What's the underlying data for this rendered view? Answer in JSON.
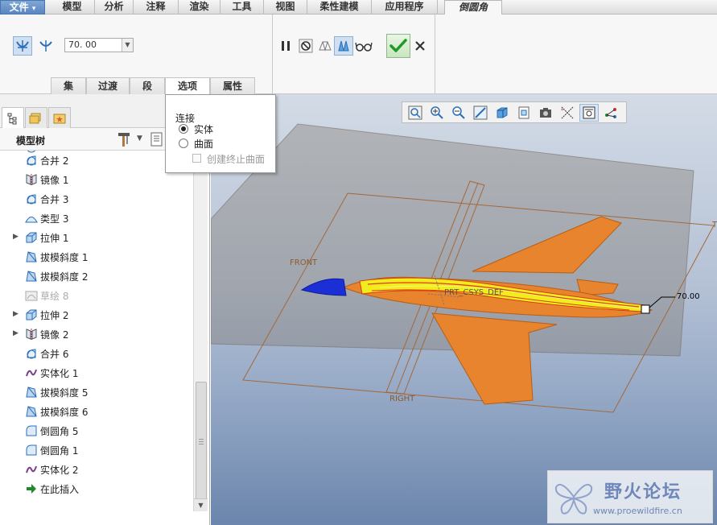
{
  "menu": {
    "tabs": [
      "文件",
      "模型",
      "分析",
      "注释",
      "渲染",
      "工具",
      "视图",
      "柔性建模",
      "应用程序",
      "倒圆角"
    ],
    "file_arrow": "▾"
  },
  "ribbon": {
    "radius_value": "70. 00",
    "slide_tabs": [
      "集",
      "过渡",
      "段",
      "选项",
      "属性"
    ]
  },
  "options_popup": {
    "title": "连接",
    "options": [
      "实体",
      "曲面"
    ],
    "selected": "实体",
    "checkbox_label": "创建终止曲面",
    "checkbox_checked": false
  },
  "model_tree": {
    "title": "模型树",
    "items": [
      {
        "label": "合并 2",
        "icon": "merge-icon",
        "expandable": false,
        "dim": false
      },
      {
        "label": "镜像 1",
        "icon": "mirror-icon",
        "expandable": false,
        "dim": false
      },
      {
        "label": "合并 3",
        "icon": "merge-icon",
        "expandable": false,
        "dim": false
      },
      {
        "label": "类型 3",
        "icon": "style-icon",
        "expandable": false,
        "dim": false
      },
      {
        "label": "拉伸 1",
        "icon": "extrude-icon",
        "expandable": true,
        "dim": false
      },
      {
        "label": "拔模斜度 1",
        "icon": "draft-icon",
        "expandable": false,
        "dim": false
      },
      {
        "label": "拔模斜度 2",
        "icon": "draft-icon",
        "expandable": false,
        "dim": false
      },
      {
        "label": "草绘 8",
        "icon": "sketch-icon",
        "expandable": false,
        "dim": true
      },
      {
        "label": "拉伸 2",
        "icon": "extrude-icon",
        "expandable": true,
        "dim": false
      },
      {
        "label": "镜像 2",
        "icon": "mirror-icon",
        "expandable": true,
        "dim": false
      },
      {
        "label": "合并 6",
        "icon": "merge-icon",
        "expandable": false,
        "dim": false
      },
      {
        "label": "实体化 1",
        "icon": "solidify-icon",
        "expandable": false,
        "dim": false
      },
      {
        "label": "拔模斜度 5",
        "icon": "draft-icon",
        "expandable": false,
        "dim": false
      },
      {
        "label": "拔模斜度 6",
        "icon": "draft-icon",
        "expandable": false,
        "dim": false
      },
      {
        "label": "倒圆角 5",
        "icon": "round-icon",
        "expandable": false,
        "dim": false
      },
      {
        "label": "倒圆角 1",
        "icon": "round-icon",
        "expandable": false,
        "dim": false
      },
      {
        "label": "实体化 2",
        "icon": "solidify-icon",
        "expandable": false,
        "dim": false
      },
      {
        "label": "在此插入",
        "icon": "insert-arrow-icon",
        "expandable": false,
        "dim": false
      }
    ]
  },
  "viewport": {
    "labels": {
      "front": "FRONT",
      "right": "RIGHT",
      "top": "T",
      "csys": "PRT_CSYS_DEF",
      "dimension": "70.00"
    }
  },
  "watermark": {
    "name": "野火论坛",
    "url": "www.proewildfire.cn"
  },
  "colors": {
    "accent": "#5a86c0",
    "fuselage": "#e8832e",
    "highlight": "#f2f21a",
    "nose": "#1c2fd6"
  }
}
